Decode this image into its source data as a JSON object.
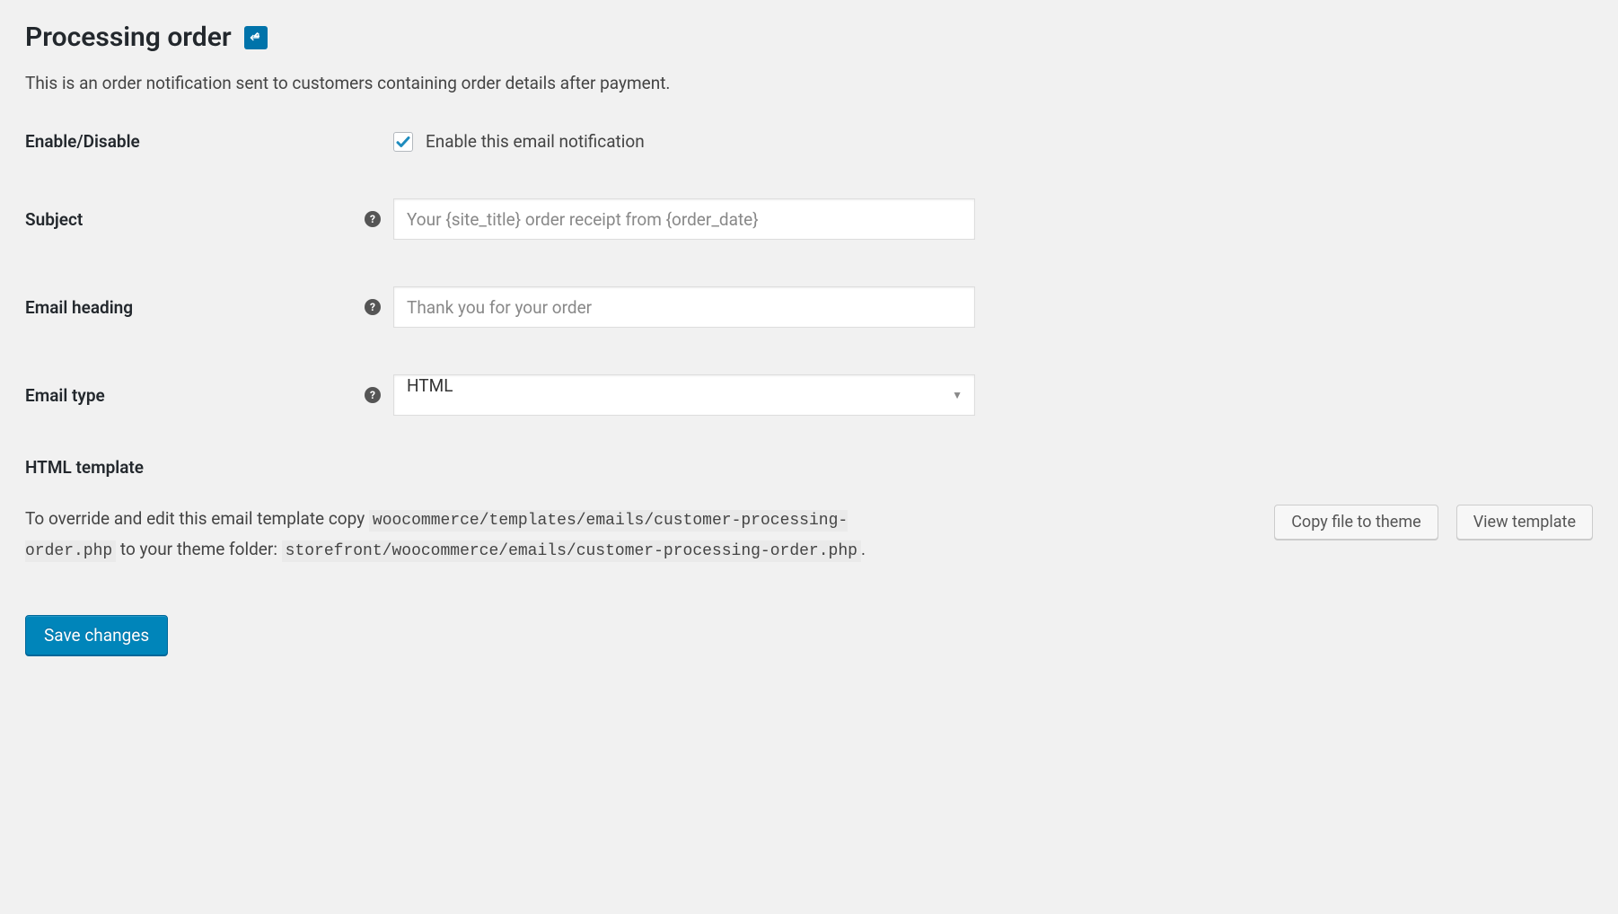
{
  "page": {
    "title": "Processing order",
    "description": "This is an order notification sent to customers containing order details after payment."
  },
  "fields": {
    "enable": {
      "label": "Enable/Disable",
      "checkbox_label": "Enable this email notification",
      "checked": true
    },
    "subject": {
      "label": "Subject",
      "placeholder": "Your {site_title} order receipt from {order_date}",
      "value": ""
    },
    "email_heading": {
      "label": "Email heading",
      "placeholder": "Thank you for your order",
      "value": ""
    },
    "email_type": {
      "label": "Email type",
      "selected": "HTML"
    }
  },
  "template": {
    "heading": "HTML template",
    "text_prefix": "To override and edit this email template copy ",
    "source_path": "woocommerce/templates/emails/customer-processing-order.php",
    "text_middle": " to your theme folder: ",
    "dest_path": "storefront/woocommerce/emails/customer-processing-order.php",
    "text_suffix": ".",
    "buttons": {
      "copy": "Copy file to theme",
      "view": "View template"
    }
  },
  "actions": {
    "save": "Save changes"
  }
}
